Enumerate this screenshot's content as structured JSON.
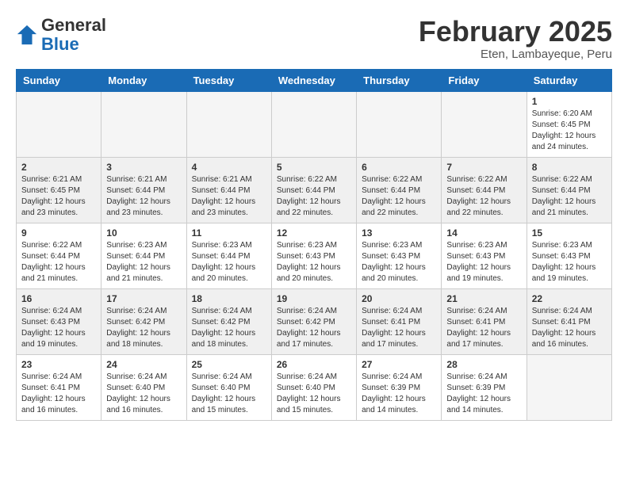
{
  "header": {
    "logo_general": "General",
    "logo_blue": "Blue",
    "month_title": "February 2025",
    "subtitle": "Eten, Lambayeque, Peru"
  },
  "weekdays": [
    "Sunday",
    "Monday",
    "Tuesday",
    "Wednesday",
    "Thursday",
    "Friday",
    "Saturday"
  ],
  "weeks": [
    {
      "alt": false,
      "days": [
        {
          "num": "",
          "info": "",
          "empty": true
        },
        {
          "num": "",
          "info": "",
          "empty": true
        },
        {
          "num": "",
          "info": "",
          "empty": true
        },
        {
          "num": "",
          "info": "",
          "empty": true
        },
        {
          "num": "",
          "info": "",
          "empty": true
        },
        {
          "num": "",
          "info": "",
          "empty": true
        },
        {
          "num": "1",
          "info": "Sunrise: 6:20 AM\nSunset: 6:45 PM\nDaylight: 12 hours and 24 minutes.",
          "empty": false
        }
      ]
    },
    {
      "alt": true,
      "days": [
        {
          "num": "2",
          "info": "Sunrise: 6:21 AM\nSunset: 6:45 PM\nDaylight: 12 hours and 23 minutes.",
          "empty": false
        },
        {
          "num": "3",
          "info": "Sunrise: 6:21 AM\nSunset: 6:44 PM\nDaylight: 12 hours and 23 minutes.",
          "empty": false
        },
        {
          "num": "4",
          "info": "Sunrise: 6:21 AM\nSunset: 6:44 PM\nDaylight: 12 hours and 23 minutes.",
          "empty": false
        },
        {
          "num": "5",
          "info": "Sunrise: 6:22 AM\nSunset: 6:44 PM\nDaylight: 12 hours and 22 minutes.",
          "empty": false
        },
        {
          "num": "6",
          "info": "Sunrise: 6:22 AM\nSunset: 6:44 PM\nDaylight: 12 hours and 22 minutes.",
          "empty": false
        },
        {
          "num": "7",
          "info": "Sunrise: 6:22 AM\nSunset: 6:44 PM\nDaylight: 12 hours and 22 minutes.",
          "empty": false
        },
        {
          "num": "8",
          "info": "Sunrise: 6:22 AM\nSunset: 6:44 PM\nDaylight: 12 hours and 21 minutes.",
          "empty": false
        }
      ]
    },
    {
      "alt": false,
      "days": [
        {
          "num": "9",
          "info": "Sunrise: 6:22 AM\nSunset: 6:44 PM\nDaylight: 12 hours and 21 minutes.",
          "empty": false
        },
        {
          "num": "10",
          "info": "Sunrise: 6:23 AM\nSunset: 6:44 PM\nDaylight: 12 hours and 21 minutes.",
          "empty": false
        },
        {
          "num": "11",
          "info": "Sunrise: 6:23 AM\nSunset: 6:44 PM\nDaylight: 12 hours and 20 minutes.",
          "empty": false
        },
        {
          "num": "12",
          "info": "Sunrise: 6:23 AM\nSunset: 6:43 PM\nDaylight: 12 hours and 20 minutes.",
          "empty": false
        },
        {
          "num": "13",
          "info": "Sunrise: 6:23 AM\nSunset: 6:43 PM\nDaylight: 12 hours and 20 minutes.",
          "empty": false
        },
        {
          "num": "14",
          "info": "Sunrise: 6:23 AM\nSunset: 6:43 PM\nDaylight: 12 hours and 19 minutes.",
          "empty": false
        },
        {
          "num": "15",
          "info": "Sunrise: 6:23 AM\nSunset: 6:43 PM\nDaylight: 12 hours and 19 minutes.",
          "empty": false
        }
      ]
    },
    {
      "alt": true,
      "days": [
        {
          "num": "16",
          "info": "Sunrise: 6:24 AM\nSunset: 6:43 PM\nDaylight: 12 hours and 19 minutes.",
          "empty": false
        },
        {
          "num": "17",
          "info": "Sunrise: 6:24 AM\nSunset: 6:42 PM\nDaylight: 12 hours and 18 minutes.",
          "empty": false
        },
        {
          "num": "18",
          "info": "Sunrise: 6:24 AM\nSunset: 6:42 PM\nDaylight: 12 hours and 18 minutes.",
          "empty": false
        },
        {
          "num": "19",
          "info": "Sunrise: 6:24 AM\nSunset: 6:42 PM\nDaylight: 12 hours and 17 minutes.",
          "empty": false
        },
        {
          "num": "20",
          "info": "Sunrise: 6:24 AM\nSunset: 6:41 PM\nDaylight: 12 hours and 17 minutes.",
          "empty": false
        },
        {
          "num": "21",
          "info": "Sunrise: 6:24 AM\nSunset: 6:41 PM\nDaylight: 12 hours and 17 minutes.",
          "empty": false
        },
        {
          "num": "22",
          "info": "Sunrise: 6:24 AM\nSunset: 6:41 PM\nDaylight: 12 hours and 16 minutes.",
          "empty": false
        }
      ]
    },
    {
      "alt": false,
      "days": [
        {
          "num": "23",
          "info": "Sunrise: 6:24 AM\nSunset: 6:41 PM\nDaylight: 12 hours and 16 minutes.",
          "empty": false
        },
        {
          "num": "24",
          "info": "Sunrise: 6:24 AM\nSunset: 6:40 PM\nDaylight: 12 hours and 16 minutes.",
          "empty": false
        },
        {
          "num": "25",
          "info": "Sunrise: 6:24 AM\nSunset: 6:40 PM\nDaylight: 12 hours and 15 minutes.",
          "empty": false
        },
        {
          "num": "26",
          "info": "Sunrise: 6:24 AM\nSunset: 6:40 PM\nDaylight: 12 hours and 15 minutes.",
          "empty": false
        },
        {
          "num": "27",
          "info": "Sunrise: 6:24 AM\nSunset: 6:39 PM\nDaylight: 12 hours and 14 minutes.",
          "empty": false
        },
        {
          "num": "28",
          "info": "Sunrise: 6:24 AM\nSunset: 6:39 PM\nDaylight: 12 hours and 14 minutes.",
          "empty": false
        },
        {
          "num": "",
          "info": "",
          "empty": true
        }
      ]
    }
  ]
}
